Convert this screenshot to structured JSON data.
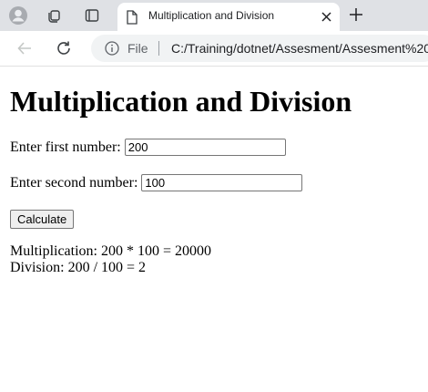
{
  "browser": {
    "tab": {
      "title": "Multiplication and Division"
    },
    "address": {
      "scheme_label": "File",
      "url": "C:/Training/dotnet/Assesment/Assesment%20"
    }
  },
  "page": {
    "heading": "Multiplication and Division",
    "first_label": "Enter first number:",
    "first_value": "200",
    "second_label": "Enter second number:",
    "second_value": "100",
    "calculate_label": "Calculate",
    "multiplication_result": "Multiplication: 200 * 100 = 20000",
    "division_result": "Division: 200 / 100 = 2"
  }
}
